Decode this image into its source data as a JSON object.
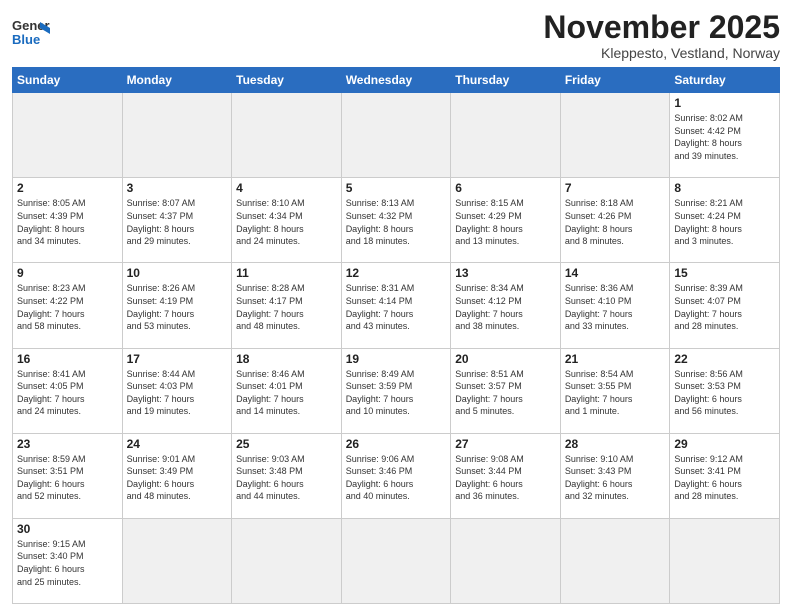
{
  "header": {
    "logo_general": "General",
    "logo_blue": "Blue",
    "month_title": "November 2025",
    "location": "Kleppesto, Vestland, Norway"
  },
  "weekdays": [
    "Sunday",
    "Monday",
    "Tuesday",
    "Wednesday",
    "Thursday",
    "Friday",
    "Saturday"
  ],
  "weeks": [
    [
      {
        "day": "",
        "info": ""
      },
      {
        "day": "",
        "info": ""
      },
      {
        "day": "",
        "info": ""
      },
      {
        "day": "",
        "info": ""
      },
      {
        "day": "",
        "info": ""
      },
      {
        "day": "",
        "info": ""
      },
      {
        "day": "1",
        "info": "Sunrise: 8:02 AM\nSunset: 4:42 PM\nDaylight: 8 hours\nand 39 minutes."
      }
    ],
    [
      {
        "day": "2",
        "info": "Sunrise: 8:05 AM\nSunset: 4:39 PM\nDaylight: 8 hours\nand 34 minutes."
      },
      {
        "day": "3",
        "info": "Sunrise: 8:07 AM\nSunset: 4:37 PM\nDaylight: 8 hours\nand 29 minutes."
      },
      {
        "day": "4",
        "info": "Sunrise: 8:10 AM\nSunset: 4:34 PM\nDaylight: 8 hours\nand 24 minutes."
      },
      {
        "day": "5",
        "info": "Sunrise: 8:13 AM\nSunset: 4:32 PM\nDaylight: 8 hours\nand 18 minutes."
      },
      {
        "day": "6",
        "info": "Sunrise: 8:15 AM\nSunset: 4:29 PM\nDaylight: 8 hours\nand 13 minutes."
      },
      {
        "day": "7",
        "info": "Sunrise: 8:18 AM\nSunset: 4:26 PM\nDaylight: 8 hours\nand 8 minutes."
      },
      {
        "day": "8",
        "info": "Sunrise: 8:21 AM\nSunset: 4:24 PM\nDaylight: 8 hours\nand 3 minutes."
      }
    ],
    [
      {
        "day": "9",
        "info": "Sunrise: 8:23 AM\nSunset: 4:22 PM\nDaylight: 7 hours\nand 58 minutes."
      },
      {
        "day": "10",
        "info": "Sunrise: 8:26 AM\nSunset: 4:19 PM\nDaylight: 7 hours\nand 53 minutes."
      },
      {
        "day": "11",
        "info": "Sunrise: 8:28 AM\nSunset: 4:17 PM\nDaylight: 7 hours\nand 48 minutes."
      },
      {
        "day": "12",
        "info": "Sunrise: 8:31 AM\nSunset: 4:14 PM\nDaylight: 7 hours\nand 43 minutes."
      },
      {
        "day": "13",
        "info": "Sunrise: 8:34 AM\nSunset: 4:12 PM\nDaylight: 7 hours\nand 38 minutes."
      },
      {
        "day": "14",
        "info": "Sunrise: 8:36 AM\nSunset: 4:10 PM\nDaylight: 7 hours\nand 33 minutes."
      },
      {
        "day": "15",
        "info": "Sunrise: 8:39 AM\nSunset: 4:07 PM\nDaylight: 7 hours\nand 28 minutes."
      }
    ],
    [
      {
        "day": "16",
        "info": "Sunrise: 8:41 AM\nSunset: 4:05 PM\nDaylight: 7 hours\nand 24 minutes."
      },
      {
        "day": "17",
        "info": "Sunrise: 8:44 AM\nSunset: 4:03 PM\nDaylight: 7 hours\nand 19 minutes."
      },
      {
        "day": "18",
        "info": "Sunrise: 8:46 AM\nSunset: 4:01 PM\nDaylight: 7 hours\nand 14 minutes."
      },
      {
        "day": "19",
        "info": "Sunrise: 8:49 AM\nSunset: 3:59 PM\nDaylight: 7 hours\nand 10 minutes."
      },
      {
        "day": "20",
        "info": "Sunrise: 8:51 AM\nSunset: 3:57 PM\nDaylight: 7 hours\nand 5 minutes."
      },
      {
        "day": "21",
        "info": "Sunrise: 8:54 AM\nSunset: 3:55 PM\nDaylight: 7 hours\nand 1 minute."
      },
      {
        "day": "22",
        "info": "Sunrise: 8:56 AM\nSunset: 3:53 PM\nDaylight: 6 hours\nand 56 minutes."
      }
    ],
    [
      {
        "day": "23",
        "info": "Sunrise: 8:59 AM\nSunset: 3:51 PM\nDaylight: 6 hours\nand 52 minutes."
      },
      {
        "day": "24",
        "info": "Sunrise: 9:01 AM\nSunset: 3:49 PM\nDaylight: 6 hours\nand 48 minutes."
      },
      {
        "day": "25",
        "info": "Sunrise: 9:03 AM\nSunset: 3:48 PM\nDaylight: 6 hours\nand 44 minutes."
      },
      {
        "day": "26",
        "info": "Sunrise: 9:06 AM\nSunset: 3:46 PM\nDaylight: 6 hours\nand 40 minutes."
      },
      {
        "day": "27",
        "info": "Sunrise: 9:08 AM\nSunset: 3:44 PM\nDaylight: 6 hours\nand 36 minutes."
      },
      {
        "day": "28",
        "info": "Sunrise: 9:10 AM\nSunset: 3:43 PM\nDaylight: 6 hours\nand 32 minutes."
      },
      {
        "day": "29",
        "info": "Sunrise: 9:12 AM\nSunset: 3:41 PM\nDaylight: 6 hours\nand 28 minutes."
      }
    ],
    [
      {
        "day": "30",
        "info": "Sunrise: 9:15 AM\nSunset: 3:40 PM\nDaylight: 6 hours\nand 25 minutes."
      },
      {
        "day": "",
        "info": ""
      },
      {
        "day": "",
        "info": ""
      },
      {
        "day": "",
        "info": ""
      },
      {
        "day": "",
        "info": ""
      },
      {
        "day": "",
        "info": ""
      },
      {
        "day": "",
        "info": ""
      }
    ]
  ]
}
